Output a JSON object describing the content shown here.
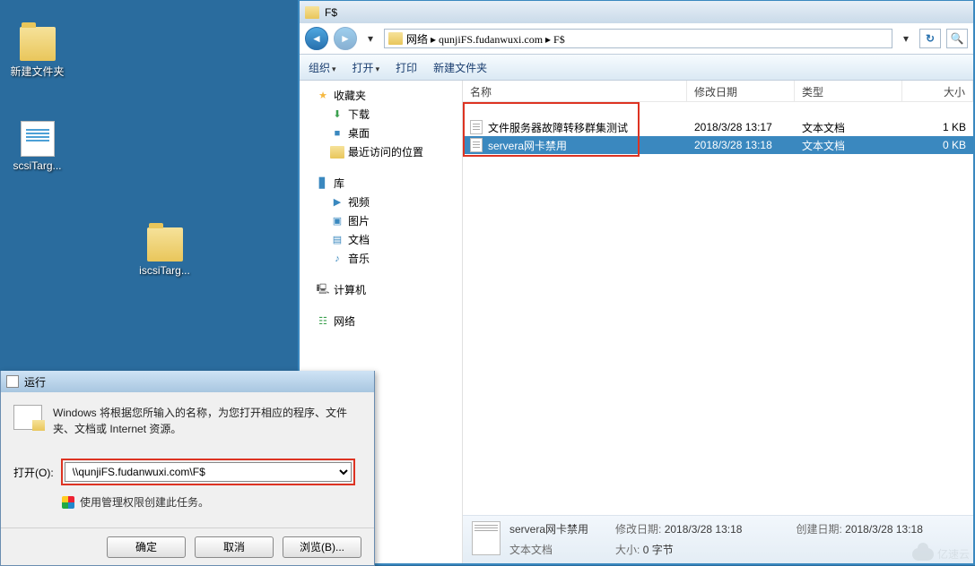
{
  "desktop": {
    "icons": [
      {
        "label": "新建文件夹",
        "kind": "folder"
      },
      {
        "label": "scsiTarg...",
        "kind": "doc"
      },
      {
        "label": "iscsiTarg...",
        "kind": "folder"
      }
    ]
  },
  "explorer": {
    "title": "F$",
    "address_path": "网络 ▸ qunjiFS.fudanwuxi.com ▸ F$",
    "toolbar": {
      "organize": "组织",
      "open": "打开",
      "print": "打印",
      "newfolder": "新建文件夹"
    },
    "nav": {
      "favorites": "收藏夹",
      "favorites_items": [
        "下载",
        "桌面",
        "最近访问的位置"
      ],
      "libraries": "库",
      "libraries_items": [
        "视频",
        "图片",
        "文档",
        "音乐"
      ],
      "computer": "计算机",
      "network": "网络"
    },
    "columns": {
      "name": "名称",
      "date": "修改日期",
      "type": "类型",
      "size": "大小"
    },
    "files": [
      {
        "name": "文件服务器故障转移群集测试",
        "date": "2018/3/28 13:17",
        "type": "文本文档",
        "size": "1 KB",
        "selected": false
      },
      {
        "name": "servera网卡禁用",
        "date": "2018/3/28 13:18",
        "type": "文本文档",
        "size": "0 KB",
        "selected": true
      }
    ],
    "status": {
      "name": "servera网卡禁用",
      "mod_label": "修改日期:",
      "mod_value": "2018/3/28 13:18",
      "create_label": "创建日期:",
      "create_value": "2018/3/28 13:18",
      "type": "文本文档",
      "size_label": "大小:",
      "size_value": "0 字节"
    }
  },
  "run": {
    "title": "运行",
    "desc": "Windows 将根据您所输入的名称，为您打开相应的程序、文件夹、文档或 Internet 资源。",
    "open_label": "打开(O):",
    "input_value": "\\\\qunjiFS.fudanwuxi.com\\F$",
    "admin_note": "使用管理权限创建此任务。",
    "ok": "确定",
    "cancel": "取消",
    "browse": "浏览(B)..."
  },
  "watermark": "亿速云"
}
